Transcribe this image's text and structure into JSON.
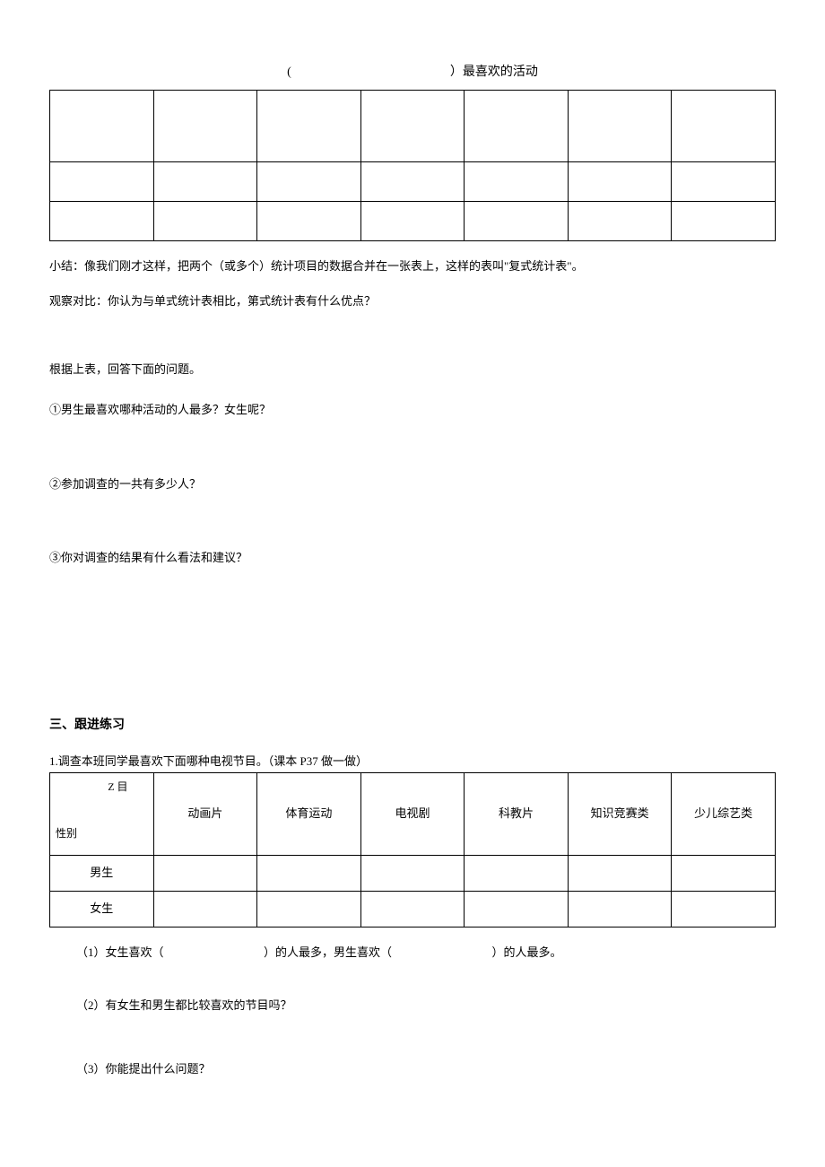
{
  "table1_title_left": "(",
  "table1_title_right": "）最喜欢的活动",
  "summary_text": "小结：像我们刚才这样，把两个（或多个）统计项目的数据合并在一张表上，这样的表叫\"复式统计表\"。",
  "observe_text": "观察对比：你认为与单式统计表相比，第式统计表有什么优点？",
  "answer_prompt": "根据上表，回答下面的问题。",
  "q1": "①男生最喜欢哪种活动的人最多？女生呢？",
  "q2": "②参加调查的一共有多少人？",
  "q3": "③你对调查的结果有什么看法和建议？",
  "section3_title": "三、跟进练习",
  "survey_intro": "1.调查本班同学最喜欢下面哪种电视节目。（课本 P37 做一做）",
  "tbl2_diag_top": "Z 目",
  "tbl2_diag_bot": "性别",
  "tbl2_headers": [
    "动画片",
    "体育运动",
    "电视剧",
    "科教片",
    "知识竞赛类",
    "少儿综艺类"
  ],
  "tbl2_rows": [
    "男生",
    "女生"
  ],
  "sub_q1_a": "（1）女生喜欢（",
  "sub_q1_b": "）的人最多，男生喜欢（",
  "sub_q1_c": "）的人最多。",
  "sub_q2": "（2）有女生和男生都比较喜欢的节目吗？",
  "sub_q3": "（3）你能提出什么问题？"
}
